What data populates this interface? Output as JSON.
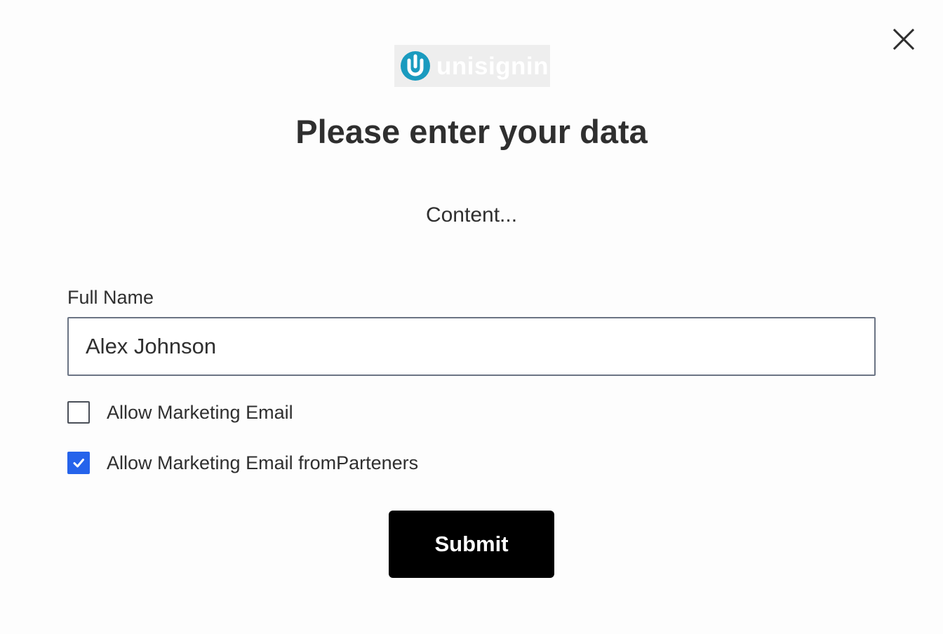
{
  "dialog": {
    "close_icon": "close-icon",
    "logo": {
      "text": "unisignin",
      "icon": "unisignin-logo-icon",
      "mark_color": "#1a9bbf",
      "background_color": "#eeeeee"
    },
    "title": "Please enter your data",
    "content": "Content...",
    "form": {
      "full_name_label": "Full Name",
      "full_name_value": "Alex Johnson",
      "checkboxes": [
        {
          "label": "Allow Marketing Email",
          "checked": false
        },
        {
          "label": "Allow Marketing Email fromParteners",
          "checked": true
        }
      ],
      "checkbox_checked_color": "#2563eb",
      "submit_label": "Submit"
    }
  }
}
